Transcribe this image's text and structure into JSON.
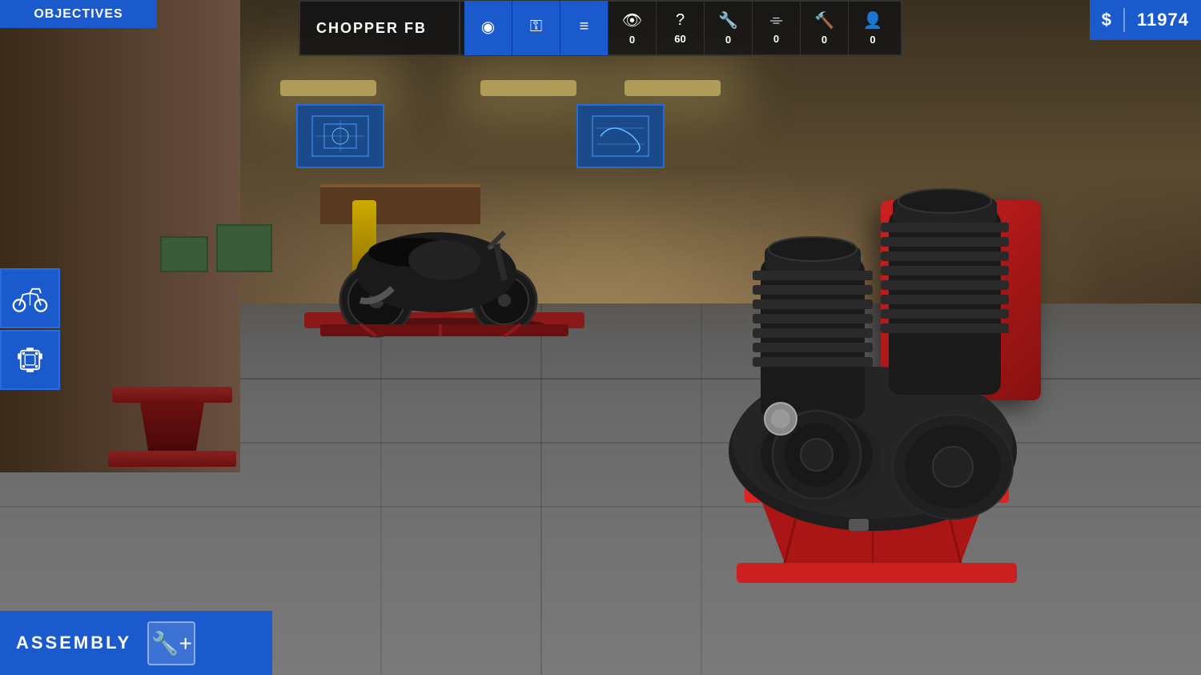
{
  "header": {
    "objectives_label": "Objectives",
    "vehicle_name": "CHOPPER FB",
    "money_icon": "$",
    "money_amount": "11974"
  },
  "toolbar": {
    "tools": [
      {
        "id": "headlights",
        "icon": "💡",
        "count": "",
        "active": true,
        "label": "headlights"
      },
      {
        "id": "keys",
        "icon": "🔑",
        "count": "",
        "active": true,
        "label": "keys"
      },
      {
        "id": "list",
        "icon": "📋",
        "count": "",
        "active": true,
        "label": "parts-list"
      },
      {
        "id": "eye",
        "icon": "👁",
        "count": "0",
        "active": false,
        "label": "inspect"
      },
      {
        "id": "question",
        "icon": "?",
        "count": "60",
        "active": false,
        "label": "help"
      },
      {
        "id": "wrench",
        "icon": "🔧",
        "count": "0",
        "active": false,
        "label": "repair"
      },
      {
        "id": "ruler",
        "icon": "📐",
        "count": "0",
        "active": false,
        "label": "measure"
      },
      {
        "id": "hammer",
        "icon": "🔨",
        "count": "0",
        "active": false,
        "label": "hammer"
      },
      {
        "id": "person",
        "icon": "👤",
        "count": "0",
        "active": false,
        "label": "character"
      }
    ]
  },
  "left_panel": {
    "items": [
      {
        "id": "motorcycle",
        "label": "motorcycle-icon"
      },
      {
        "id": "engine",
        "label": "engine-icon"
      }
    ]
  },
  "assembly": {
    "label": "ASSEMBLY",
    "icon": "🔧"
  },
  "scene": {
    "background_desc": "Motorcycle repair garage with engine on stand",
    "engine_on_stand": true,
    "motorcycle_on_lift": true
  }
}
